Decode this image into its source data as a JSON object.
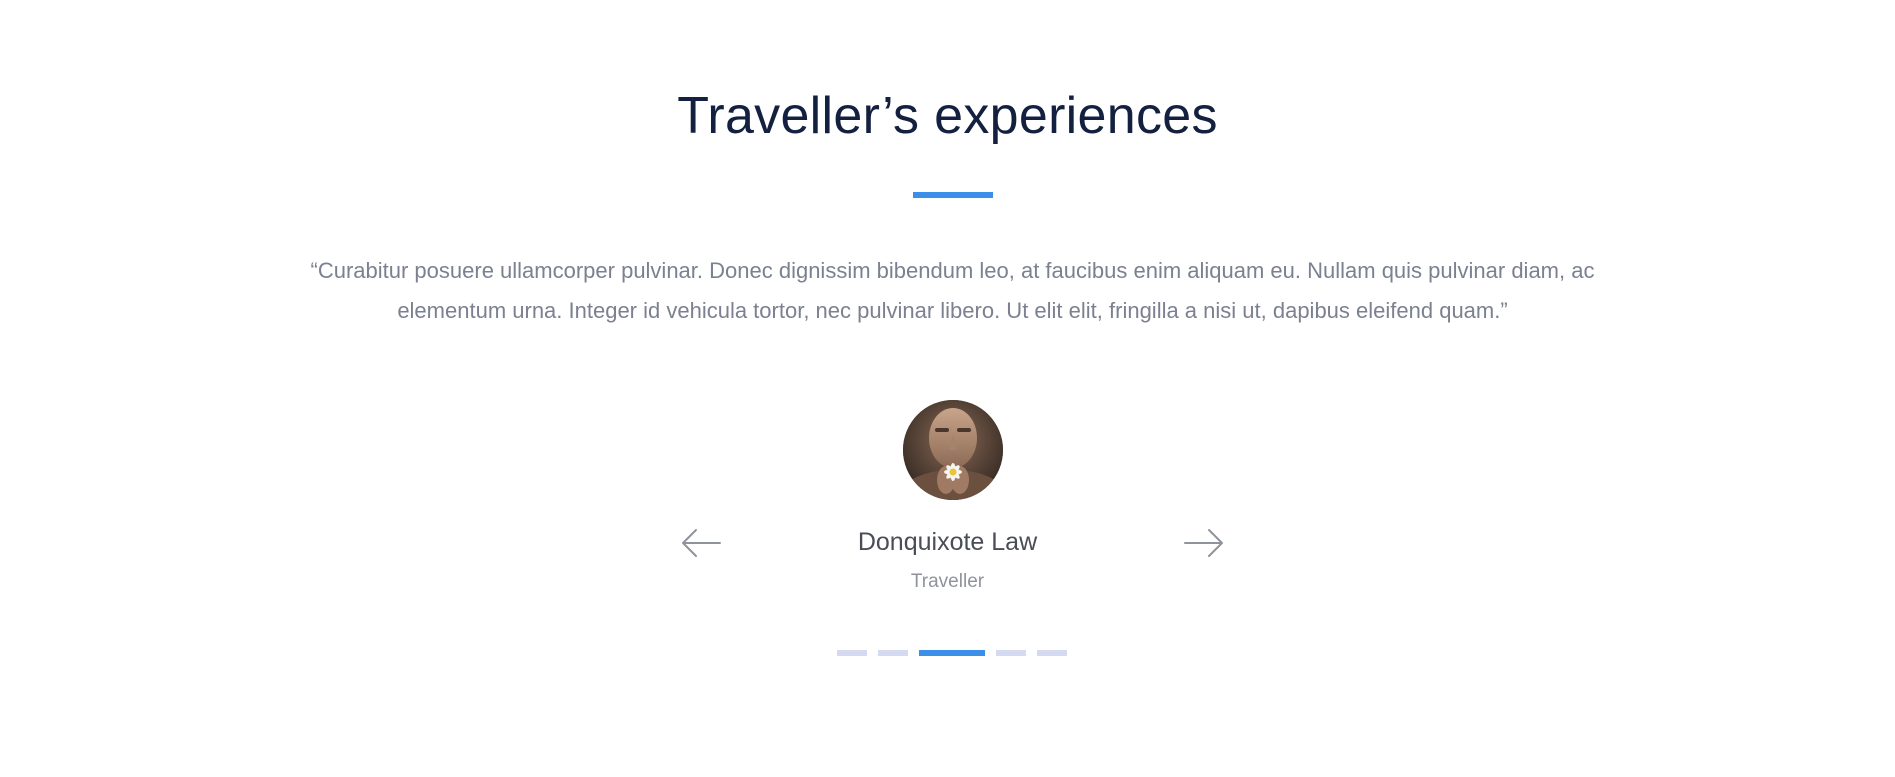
{
  "section": {
    "title": "Traveller’s experiences",
    "accent_color": "#3b8fe8",
    "title_color": "#13203f"
  },
  "testimonial": {
    "quote": "“Curabitur posuere ullamcorper pulvinar. Donec dignissim bibendum leo, at faucibus enim aliquam eu. Nullam quis pulvinar diam, ac elementum urna. Integer id vehicula tortor, nec pulvinar libero. Ut elit elit, fringilla a nisi ut, dapibus eleifend quam.”",
    "author_name": "Donquixote Law",
    "author_role": "Traveller",
    "avatar_icon": "person-holding-flower-photo"
  },
  "navigation": {
    "prev_icon": "arrow-left-icon",
    "next_icon": "arrow-right-icon"
  },
  "pagination": {
    "total": 5,
    "active_index": 2,
    "inactive_color": "#d5daf0",
    "active_color": "#3b8fe8"
  }
}
